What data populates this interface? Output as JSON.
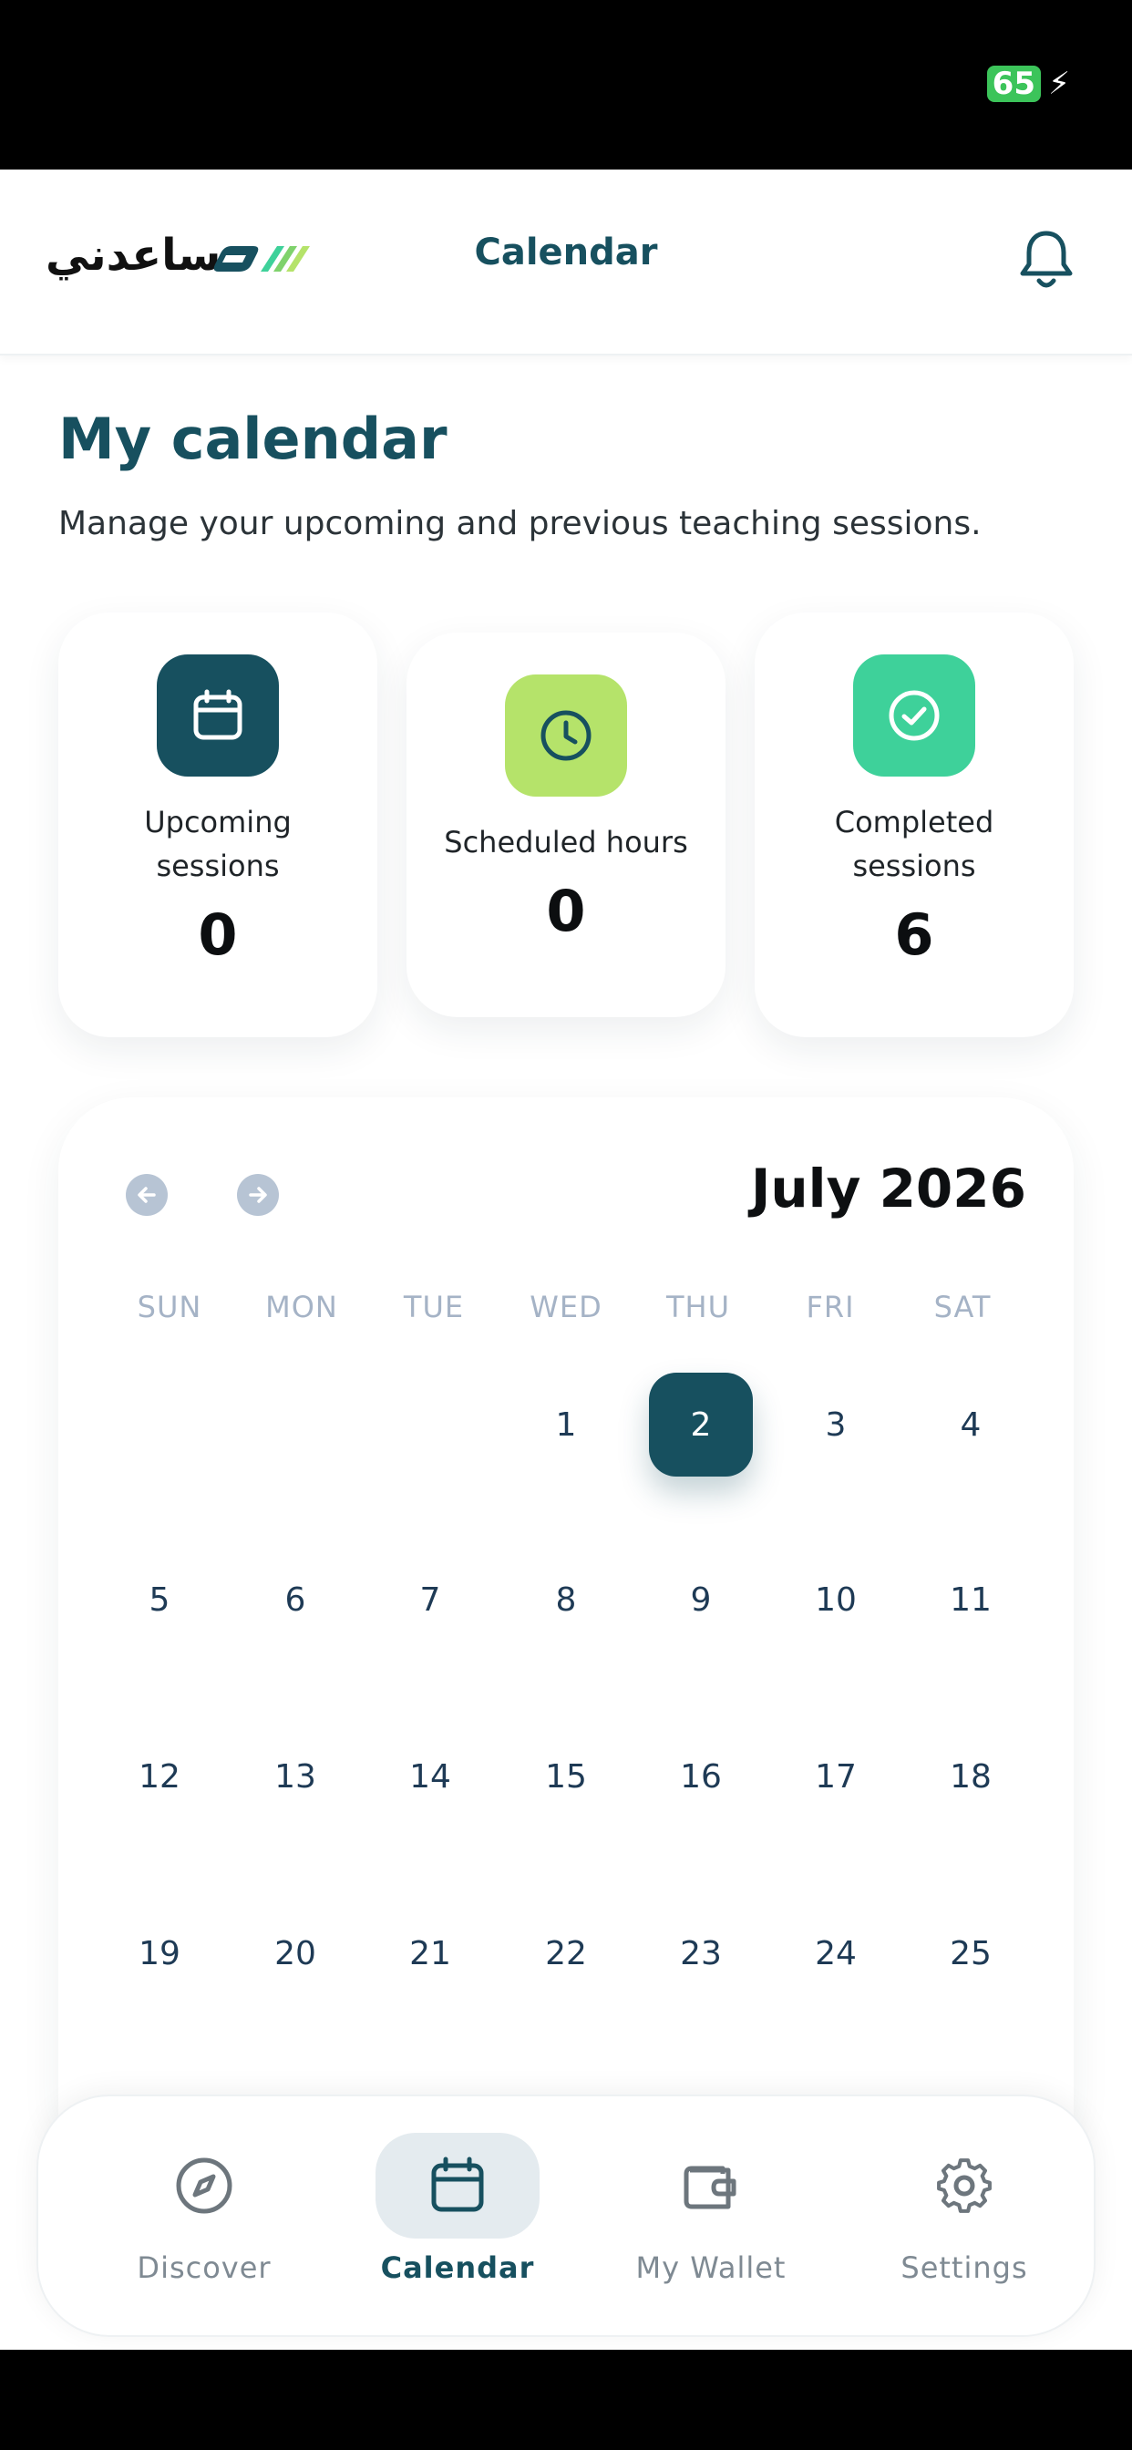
{
  "status_bar": {
    "battery": "65"
  },
  "header": {
    "brand_text": "ساعدني",
    "title": "Calendar",
    "notifications_icon": "bell-icon"
  },
  "page": {
    "title": "My calendar",
    "subtitle": "Manage your upcoming and previous teaching sessions."
  },
  "stats": [
    {
      "label": "Upcoming sessions",
      "value": "0",
      "icon": "calendar-icon",
      "color": "#17505f"
    },
    {
      "label": "Scheduled hours",
      "value": "0",
      "icon": "clock-icon",
      "color": "#b5e36a"
    },
    {
      "label": "Completed sessions",
      "value": "6",
      "icon": "check-circle-icon",
      "color": "#3ed19a"
    }
  ],
  "calendar": {
    "month_label": "July 2026",
    "weekdays": [
      "SUN",
      "MON",
      "TUE",
      "WED",
      "THU",
      "FRI",
      "SAT"
    ],
    "selected_day": "2",
    "days": [
      "1",
      "2",
      "3",
      "4",
      "5",
      "6",
      "7",
      "8",
      "9",
      "10",
      "11",
      "12",
      "13",
      "14",
      "15",
      "16",
      "17",
      "18",
      "19",
      "20",
      "21",
      "22",
      "23",
      "24",
      "25"
    ],
    "prev_icon": "arrow-left-icon",
    "next_icon": "arrow-right-icon"
  },
  "tabs": [
    {
      "label": "Discover",
      "icon": "compass-icon",
      "active": false
    },
    {
      "label": "Calendar",
      "icon": "calendar-icon",
      "active": true
    },
    {
      "label": "My Wallet",
      "icon": "wallet-icon",
      "active": false
    },
    {
      "label": "Settings",
      "icon": "gear-icon",
      "active": false
    }
  ],
  "colors": {
    "primary": "#17505f",
    "accent_lime": "#b5e36a",
    "accent_green": "#3ed19a",
    "weekday": "#a5b3c6"
  }
}
